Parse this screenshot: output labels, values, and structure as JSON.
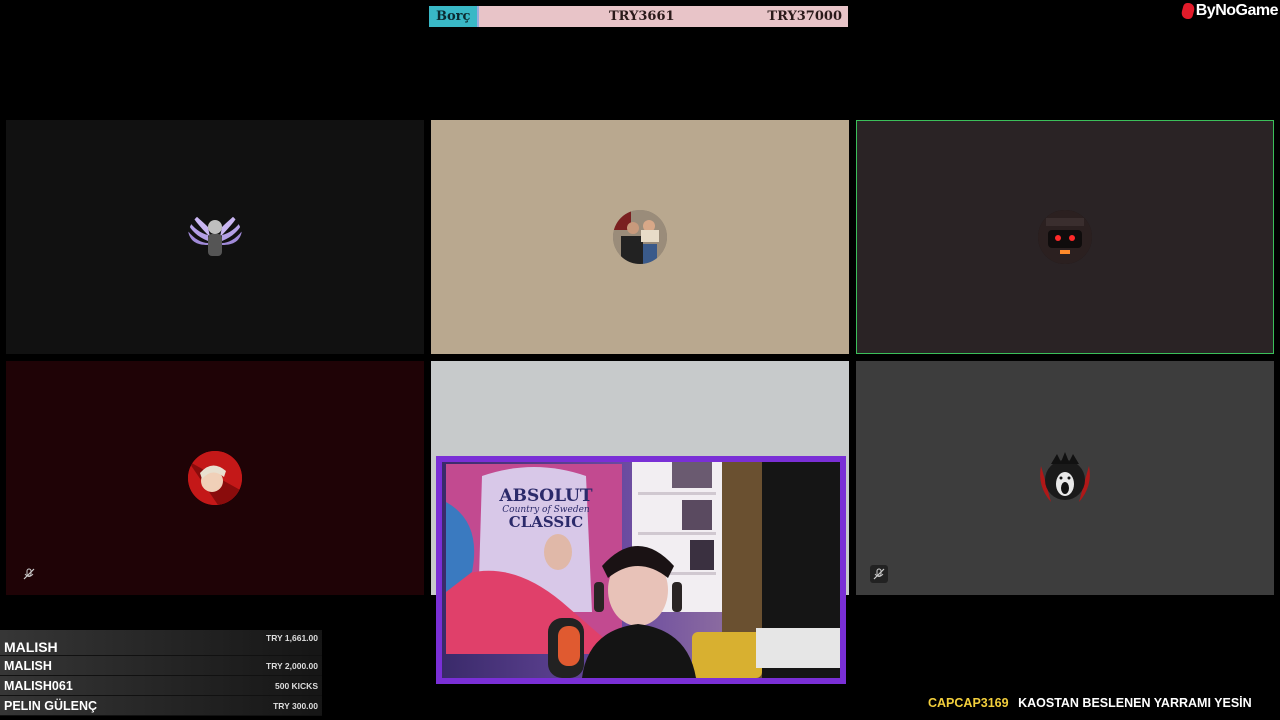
{
  "debt_bar": {
    "label": "Borç",
    "current": "TRY3661",
    "target": "TRY37000",
    "label_color": "#39b8c6",
    "bar_color": "#e8c4c8"
  },
  "brand": {
    "name": "ByNoGame",
    "icon": "bynogame-logo-icon",
    "color": "#e21b2a"
  },
  "tiles": [
    {
      "id": "participant-1",
      "bg": "#111111",
      "avatar": "winged-angel-avatar"
    },
    {
      "id": "participant-2",
      "bg": "#b9a88f",
      "avatar": "person-holding-sign-avatar"
    },
    {
      "id": "participant-3",
      "bg": "#2a2325",
      "avatar": "red-eyed-car-avatar",
      "speaking": true,
      "border": "#3bbf5a"
    },
    {
      "id": "participant-4",
      "bg": "#1f0306",
      "avatar": "red-hair-anime-avatar",
      "muted": true
    },
    {
      "id": "participant-5",
      "bg": "#c7cacb",
      "avatar": ""
    },
    {
      "id": "participant-6",
      "bg": "#3d3d3d",
      "avatar": "screaming-skull-avatar",
      "muted": true
    }
  ],
  "webcam": {
    "border_color": "#7a2fd6",
    "poster_text": [
      "ABSOLUT",
      "Country of Sweden",
      "CLASSIC"
    ]
  },
  "donations": [
    {
      "name": "MALISH",
      "amount": "TRY 1,661.00"
    },
    {
      "name": "MALISH",
      "amount": "TRY 2,000.00"
    },
    {
      "name": "MALISH061",
      "amount": "500 KICKS"
    },
    {
      "name": "PELIN GÜLENÇ",
      "amount": "TRY 300.00"
    }
  ],
  "ticker": {
    "user": "CAPCAP3169",
    "message": "KAOSTAN BESLENEN YARRAMI YESİN",
    "user_color": "#f3cf3c"
  }
}
